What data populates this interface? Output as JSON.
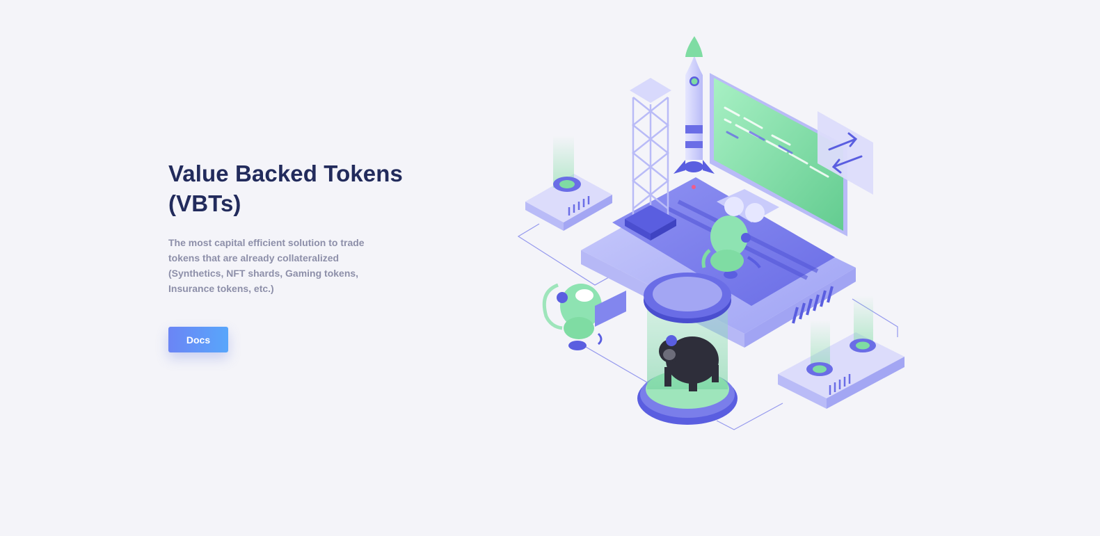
{
  "hero": {
    "title_line1": "Value Backed Tokens",
    "title_line2": "(VBTs)",
    "description": "The most capital efficient solution to trade tokens that are already collateralized (Synthetics, NFT shards, Gaming tokens, Insurance tokens, etc.)",
    "docs_label": "Docs"
  },
  "colors": {
    "background": "#f4f4f9",
    "title": "#222b5c",
    "text_muted": "#8d8fa9",
    "accent_blue": "#6b85f5",
    "accent_green": "#7fdca3",
    "accent_purple": "#5a5ee0"
  },
  "illustration": {
    "alt": "isometric-launchpad-illustration",
    "icons": [
      "rocket-icon",
      "tower-icon",
      "monitor-icon",
      "swap-arrows-icon",
      "robot-icon",
      "gorilla-icon",
      "server-icon"
    ]
  }
}
